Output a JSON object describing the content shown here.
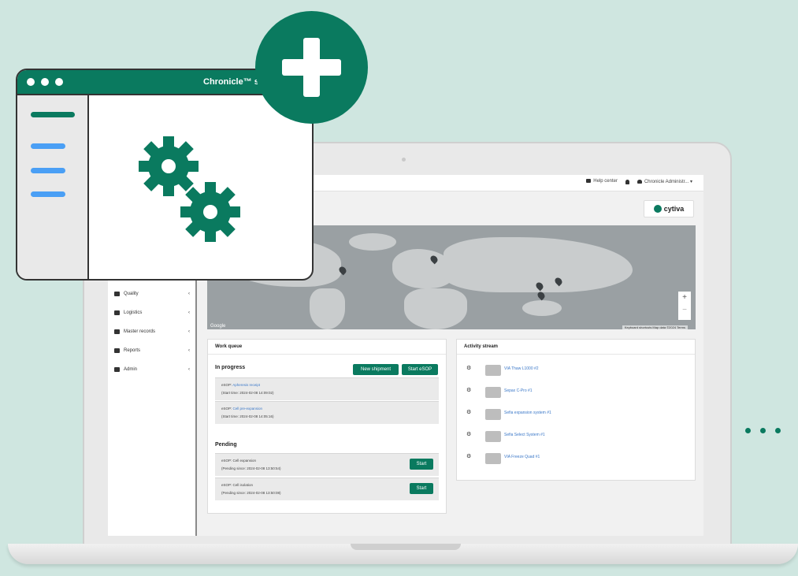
{
  "colors": {
    "brand": "#0a7a5f",
    "background": "#cfe6e0",
    "link": "#3b78c8",
    "menu_bar": "#4a9ff5"
  },
  "overlay": {
    "title": "Chronicle™ s",
    "icons": [
      "gear-icon",
      "gear-icon",
      "plus-icon"
    ]
  },
  "app": {
    "topbar": {
      "help": "Help center",
      "user": "Chronicle Administr... ▾"
    },
    "brand": "cytiva",
    "nav": [
      {
        "label": "Quality"
      },
      {
        "label": "Logistics"
      },
      {
        "label": "Master records"
      },
      {
        "label": "Reports"
      },
      {
        "label": "Admin"
      }
    ],
    "map": {
      "google": "Google",
      "footer": "Keyboard shortcuts   Map data ©2024   Terms",
      "zoom_in": "+",
      "zoom_out": "−"
    },
    "work_queue": {
      "title": "Work queue",
      "in_progress": "In progress",
      "new_shipment": "New shipment",
      "start_esop": "Start eSOP",
      "in_progress_items": [
        {
          "prefix": "eSOP:",
          "name": "Apheresis receipt",
          "time": "(Start time: 2024-02-08 14:09:02)"
        },
        {
          "prefix": "eSOP:",
          "name": "Cell pre-expansion",
          "time": "(Start time: 2024-02-08 14:05:16)"
        }
      ],
      "pending": "Pending",
      "pending_items": [
        {
          "name": "eSOP: Cell expansion",
          "time": "(Pending since: 2024-02-08 13:50:54)",
          "button": "Start"
        },
        {
          "name": "eSOP: Cell isolation",
          "time": "(Pending since: 2024-02-08 13:50:08)",
          "button": "Start"
        }
      ]
    },
    "activity": {
      "title": "Activity stream",
      "items": [
        "VIA Thaw L1000 #2",
        "Sepax C-Pro #1",
        "Sefia expansion system #1",
        "Sefia Select System #1",
        "VIA Freeze Quad #1"
      ]
    }
  }
}
